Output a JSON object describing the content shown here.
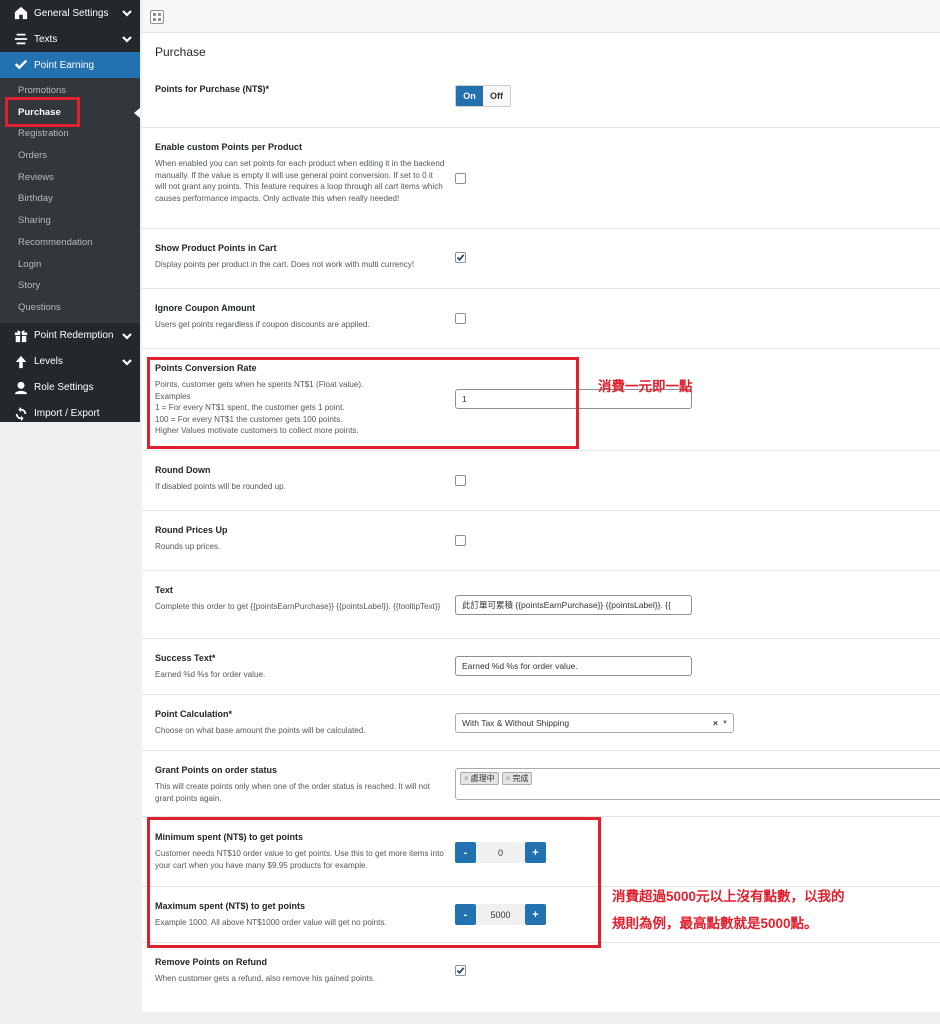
{
  "sidebar": {
    "top_items": [
      {
        "label": "General Settings",
        "icon": "home-icon"
      },
      {
        "label": "Texts",
        "icon": "align-center-icon"
      },
      {
        "label": "Point Earning",
        "icon": "checkmark-icon"
      }
    ],
    "submenu": [
      "Promotions",
      "Purchase",
      "Registration",
      "Orders",
      "Reviews",
      "Birthday",
      "Sharing",
      "Recommendation",
      "Login",
      "Story",
      "Questions"
    ],
    "bottom_items": [
      {
        "label": "Point Redemption",
        "icon": "gift-icon"
      },
      {
        "label": "Levels",
        "icon": "arrow-up-icon"
      },
      {
        "label": "Role Settings",
        "icon": "user-icon"
      },
      {
        "label": "Import / Export",
        "icon": "sync-icon"
      }
    ]
  },
  "section_title": "Purchase",
  "settings": {
    "points_for_purchase": {
      "title": "Points for Purchase (NT$)*",
      "on_label": "On",
      "off_label": "Off"
    },
    "custom_points": {
      "title": "Enable custom Points per Product",
      "description": "When enabled you can set points for each product when editing it in the backend manually. If the value is empty it will use general point conversion. If set to 0 it will not grant any points. This feature requires a loop through all cart items which causes performance impacts. Only activate this when really needed!",
      "checked": false
    },
    "show_in_cart": {
      "title": "Show Product Points in Cart",
      "description": "Display points per product in the cart. Does not work with multi currency!",
      "checked": true
    },
    "ignore_coupon": {
      "title": "Ignore Coupon Amount",
      "description": "Users get points regardless if coupon discounts are applied.",
      "checked": false
    },
    "conversion_rate": {
      "title": "Points Conversion Rate",
      "desc_1": "Points, customer gets when he spents NT$1 (Float value).",
      "desc_2": "Examples",
      "desc_3": "1 = For every NT$1 spent, the customer gets 1 point.",
      "desc_4": "100 = For every NT$1 the customer gets 100 points.",
      "desc_5": "Higher Values motivate customers to collect more points.",
      "value": "1"
    },
    "round_down": {
      "title": "Round Down",
      "description": "If disabled points will be rounded up.",
      "checked": false
    },
    "round_prices_up": {
      "title": "Round Prices Up",
      "description": "Rounds up prices.",
      "checked": false
    },
    "text": {
      "title": "Text",
      "description": "Complete this order to get {{pointsEarnPurchase}} {{pointsLabel}}. {{tooltipText}}",
      "value": "此訂單可累積 {{pointsEarnPurchase}} {{pointsLabel}}. {{"
    },
    "success_text": {
      "title": "Success Text*",
      "description": "Earned %d %s for order value.",
      "value": "Earned %d %s for order value."
    },
    "point_calculation": {
      "title": "Point Calculation*",
      "description": "Choose on what base amount the points will be calculated.",
      "value": "With Tax & Without Shipping",
      "clear": "×",
      "arrow": "▼"
    },
    "grant_status": {
      "title": "Grant Points on order status",
      "description": "This will create points only when one of the order status is reached. It will not grant points again.",
      "tags": [
        "處理中",
        "完成"
      ],
      "tag_x": "×"
    },
    "minimum_spent": {
      "title": "Minimum spent (NT$) to get points",
      "description": "Customer needs NT$10 order value to get points. Use this to get more items into your cart when you have many $9.95 products for example.",
      "value": "0",
      "minus": "-",
      "plus": "+"
    },
    "maximum_spent": {
      "title": "Maximum spent (NT$) to get points",
      "description": "Example 1000. All above NT$1000 order value will get no points.",
      "value": "5000",
      "minus": "-",
      "plus": "+"
    },
    "remove_on_refund": {
      "title": "Remove Points on Refund",
      "description": "When customer gets a refund, also remove his gained points.",
      "checked": true
    }
  },
  "annotations": {
    "conversion_note": "消費一元即一點",
    "max_note_line1": "消費超過5000元以上沒有點數，以我的",
    "max_note_line2": "規則為例，最高點數就是5000點。"
  },
  "colors": {
    "accent": "#2271b1",
    "annotation": "#e0202e",
    "sidebar": "#23282d",
    "submenu": "#32373c"
  }
}
